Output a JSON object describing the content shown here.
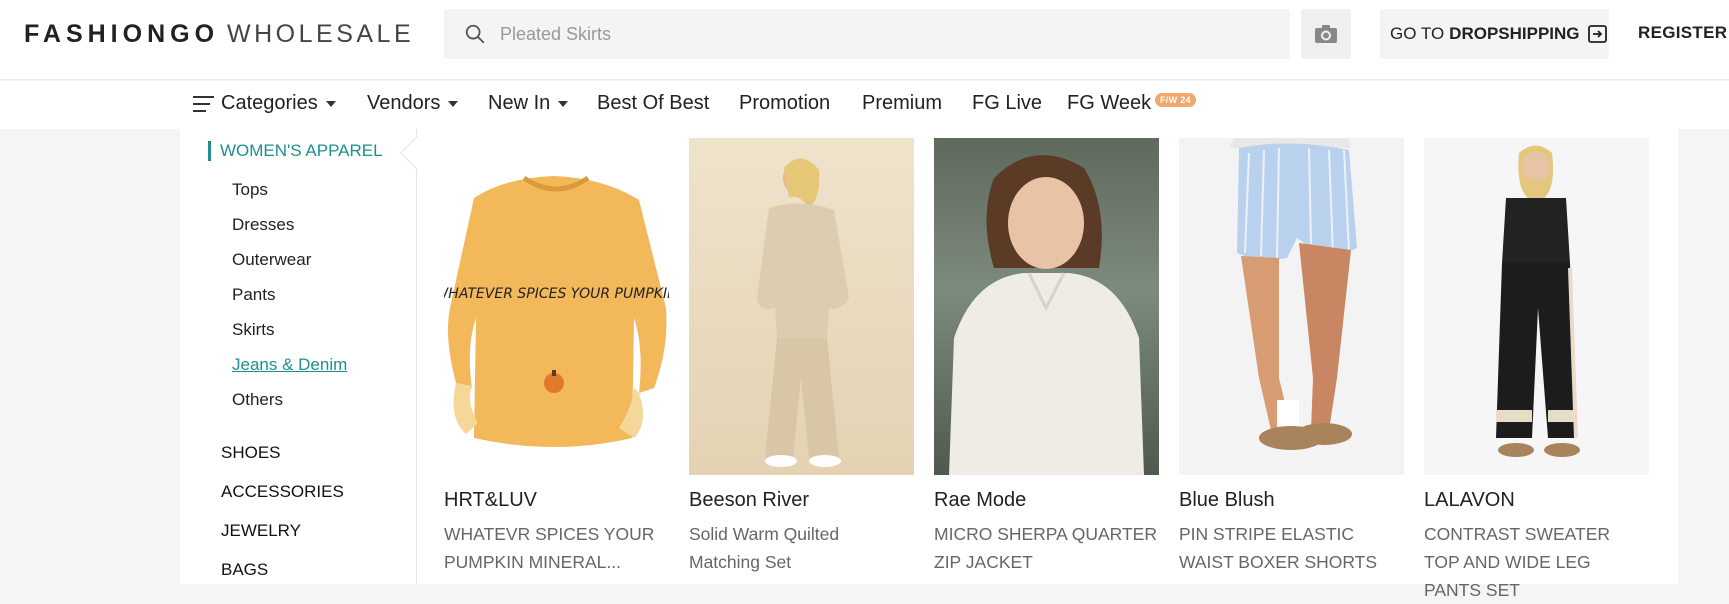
{
  "header": {
    "logo_brand": "FASHIONGO",
    "logo_sub": "WHOLESALE",
    "search_placeholder": "Pleated Skirts",
    "dropship_prefix": "GO TO",
    "dropship_bold": "DROPSHIPPING",
    "register": "REGISTER"
  },
  "nav": {
    "items": [
      "Categories",
      "Vendors",
      "New In",
      "Best Of Best",
      "Promotion",
      "Premium",
      "FG Live",
      "FG Week"
    ],
    "badge": "F/W 24"
  },
  "sidebar": {
    "heading": "WOMEN'S APPAREL",
    "subitems": [
      "Tops",
      "Dresses",
      "Outerwear",
      "Pants",
      "Skirts",
      "Jeans & Denim",
      "Others"
    ],
    "categories": [
      "SHOES",
      "ACCESSORIES",
      "JEWELRY",
      "BAGS"
    ]
  },
  "products": [
    {
      "vendor": "HRT&LUV",
      "desc": "WHATEVR SPICES YOUR PUMPKIN MINERAL...",
      "print": "WHATEVER SPICES YOUR PUMPKIN"
    },
    {
      "vendor": "Beeson River",
      "desc": "Solid Warm Quilted Matching Set"
    },
    {
      "vendor": "Rae Mode",
      "desc": "MICRO SHERPA QUARTER ZIP JACKET"
    },
    {
      "vendor": "Blue Blush",
      "desc": "PIN STRIPE ELASTIC WAIST BOXER SHORTS"
    },
    {
      "vendor": "LALAVON",
      "desc": "CONTRAST SWEATER TOP AND WIDE LEG PANTS SET"
    }
  ],
  "colors": {
    "accent": "#1e8f8f",
    "badge": "#f0a86e"
  }
}
